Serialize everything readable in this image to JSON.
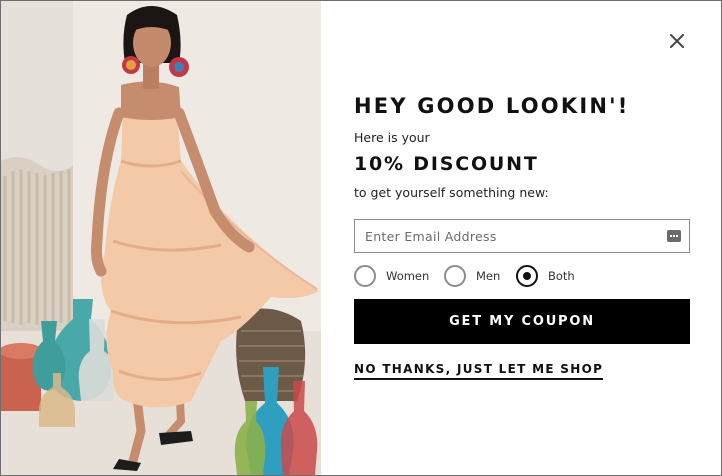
{
  "popup": {
    "headline": "HEY GOOD LOOKIN'!",
    "intro": "Here is your",
    "discount": "10% DISCOUNT",
    "subline": "to get yourself something new:",
    "email": {
      "placeholder": "Enter Email Address",
      "value": "",
      "autofill_icon": "autofill-contact-icon"
    },
    "gender_options": [
      {
        "label": "Women",
        "checked": false
      },
      {
        "label": "Men",
        "checked": false
      },
      {
        "label": "Both",
        "checked": true
      }
    ],
    "cta_label": "GET MY COUPON",
    "decline_label": "NO THANKS, JUST LET ME SHOP",
    "close_icon": "close-icon"
  },
  "hero_image": {
    "subject": "model in peach ruffled maxi dress among glass vases",
    "colors": {
      "dress": "#f3c9a8",
      "background": "#ede7e2",
      "vase_teal": "#49a9a8"
    }
  },
  "theme": {
    "accent": "#000000",
    "text": "#111111",
    "border": "#8a8a8a"
  }
}
